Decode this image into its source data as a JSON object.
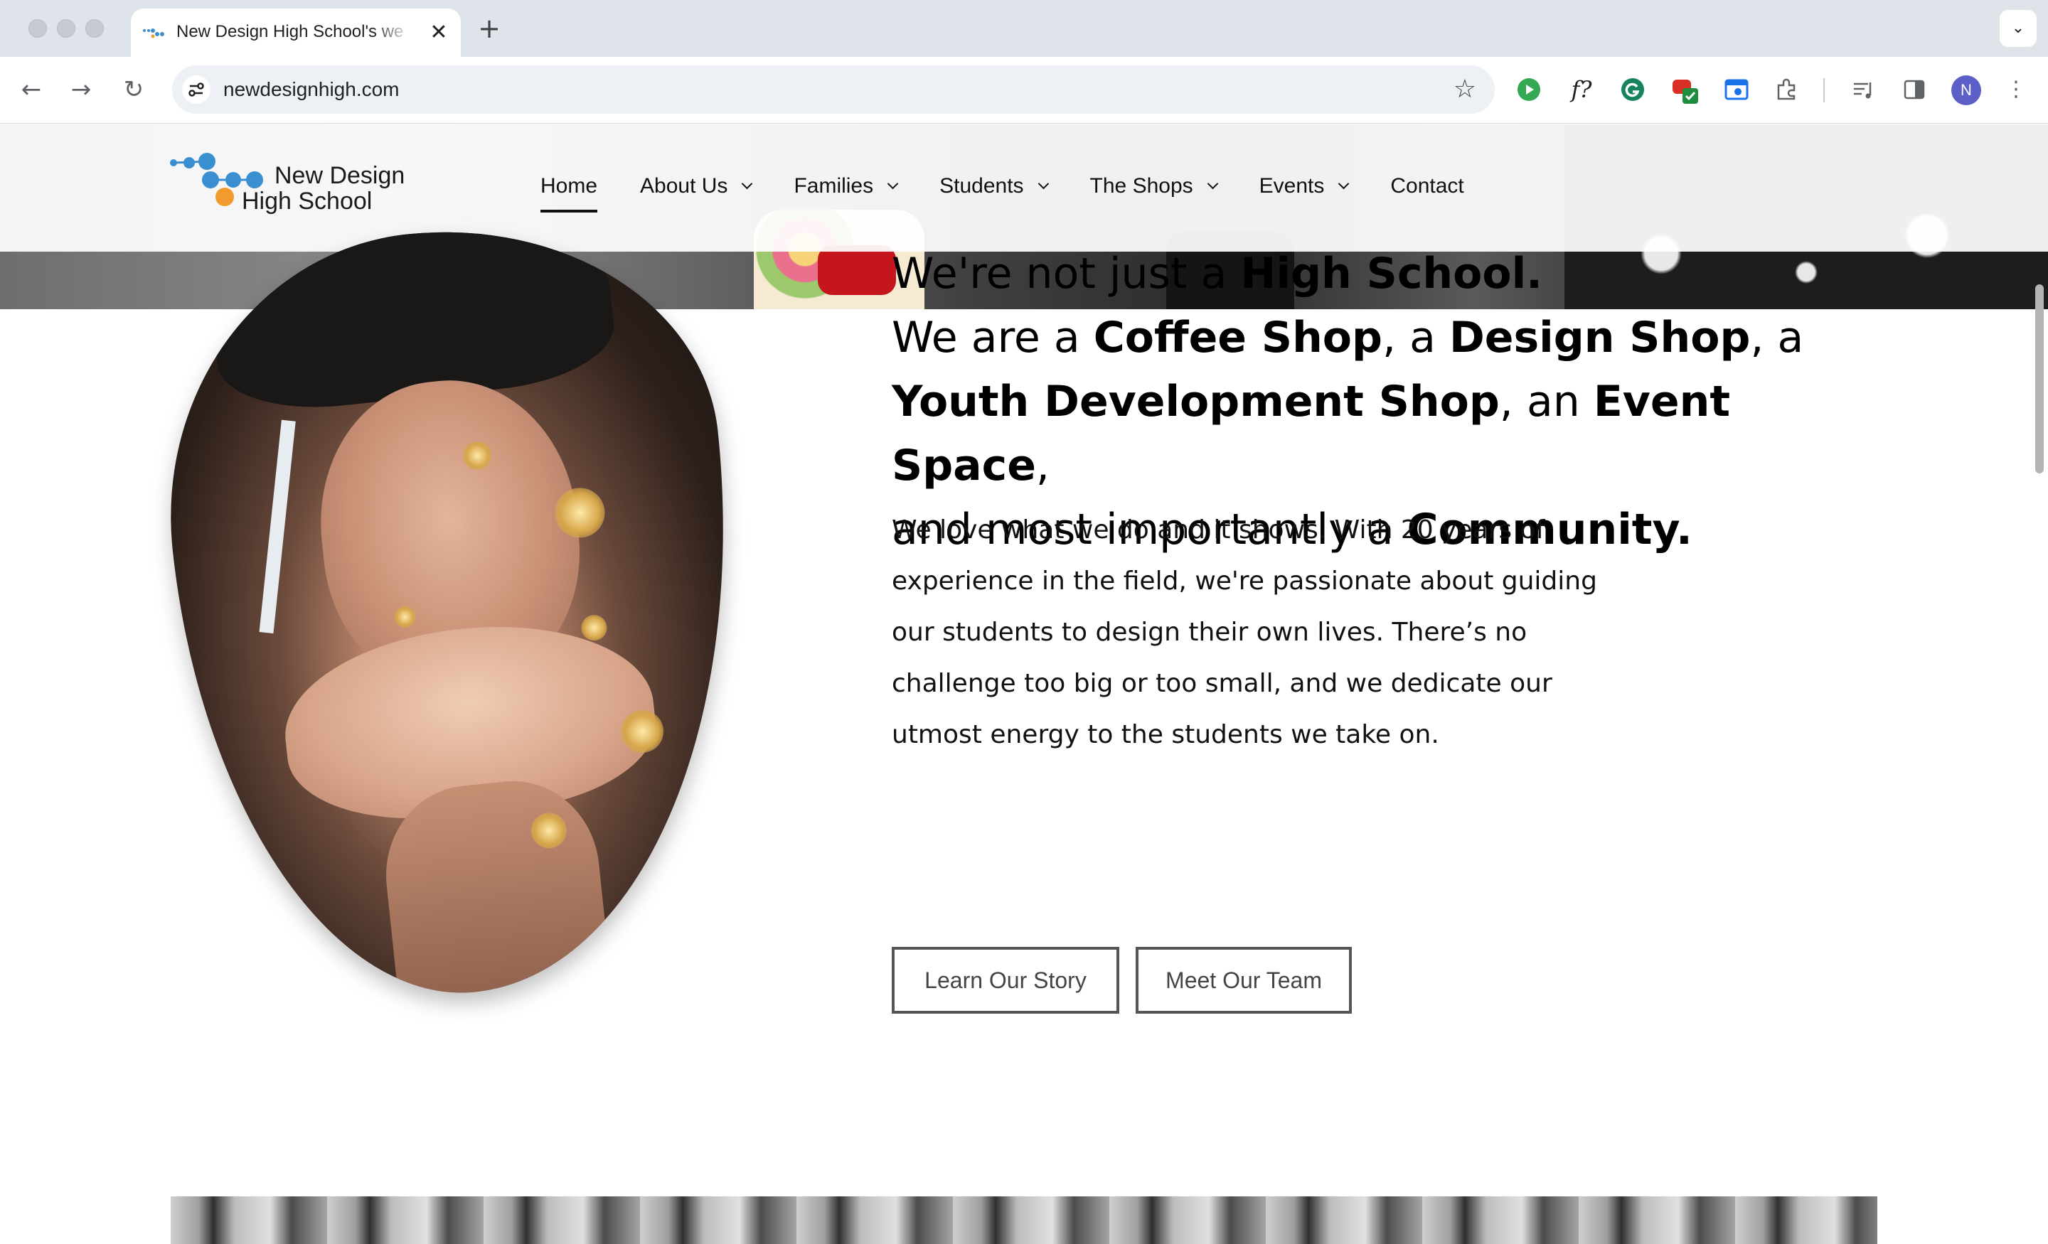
{
  "browser": {
    "tab_title": "New Design High School's we",
    "tab_close": "✕",
    "new_tab": "+",
    "tab_menu": "⌄",
    "back": "←",
    "forward": "→",
    "reload": "↻",
    "url": "newdesignhigh.com",
    "bookmark_star": "☆",
    "profile_initial": "N",
    "menu": "⋮",
    "extensions": [
      "play-icon",
      "fx-icon",
      "grammarly-icon",
      "extension-badge-icon",
      "screenshot-icon",
      "puzzle-icon",
      "media-icon",
      "sidepanel-icon"
    ],
    "ext_fx_label": "f?"
  },
  "site": {
    "logo_line1": "New Design",
    "logo_line2": "High School",
    "nav": [
      {
        "label": "Home",
        "active": true
      },
      {
        "label": "About Us",
        "dropdown": true
      },
      {
        "label": "Families",
        "dropdown": true
      },
      {
        "label": "Students",
        "dropdown": true
      },
      {
        "label": "The Shops",
        "dropdown": true
      },
      {
        "label": "Events",
        "dropdown": true
      },
      {
        "label": "Contact"
      }
    ]
  },
  "hero": {
    "h_line1_a": "We're not just a ",
    "h_line1_b": "High School.",
    "h_line2_a": "We are a ",
    "h_line2_b": "Coffee Shop",
    "h_line2_c": ", a ",
    "h_line2_d": "Design Shop",
    "h_line2_e": ", a",
    "h_line3_a": "Youth Development Shop",
    "h_line3_b": ", an ",
    "h_line3_c": "Event Space",
    "h_line3_d": ",",
    "h_line4_a": "and most importantly a ",
    "h_line4_b": "Community.",
    "body": "We love what we do and it shows. With 20 years of experience in the field, we're passionate about guiding our students to design their own lives. There’s no challenge too big or too small, and we dedicate our utmost energy to the students we take on.",
    "btn_story": "Learn Our Story",
    "btn_team": "Meet Our Team"
  },
  "colors": {
    "logo_blue": "#3a8fd1",
    "logo_orange": "#f29a2e",
    "text": "#111111",
    "button_border": "#555555"
  }
}
